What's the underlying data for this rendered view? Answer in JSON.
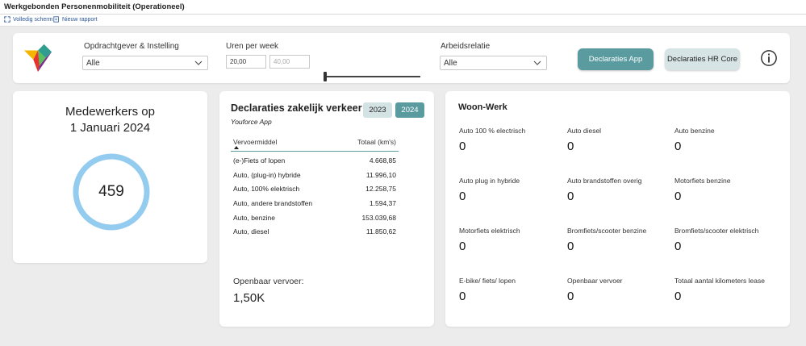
{
  "window": {
    "title": "Werkgebonden Personenmobiliteit (Operationeel)"
  },
  "toolbar": {
    "fullscreen_label": "Volledig scherm",
    "new_report_label": "Nieuw rapport"
  },
  "filters": {
    "employer": {
      "label": "Opdrachtgever & Instelling",
      "value": "Alle"
    },
    "hours": {
      "label": "Uren per week",
      "min": "20,00",
      "max": "40,00",
      "selected_fraction": 0.0
    },
    "relation": {
      "label": "Arbeidsrelatie",
      "value": "Alle"
    },
    "btn_app": "Declaraties App",
    "btn_hr": "Declaraties HR Core"
  },
  "employees": {
    "title_line1": "Medewerkers op",
    "title_line2": "1 Januari 2024",
    "count": "459"
  },
  "declaraties": {
    "title": "Declaraties zakelijk verkeer",
    "subtitle": "Youforce App",
    "years": [
      "2023",
      "2024"
    ],
    "active_year": "2024",
    "columns": [
      "Vervoermiddel",
      "Totaal (km's)"
    ],
    "rows": [
      {
        "mode": "(e-)Fiets of lopen",
        "km": "4.668,85"
      },
      {
        "mode": "Auto, (plug-in) hybride",
        "km": "11.996,10"
      },
      {
        "mode": "Auto, 100% elektrisch",
        "km": "12.258,75"
      },
      {
        "mode": "Auto, andere brandstoffen",
        "km": "1.594,37"
      },
      {
        "mode": "Auto, benzine",
        "km": "153.039,68"
      },
      {
        "mode": "Auto, diesel",
        "km": "11.850,62"
      }
    ],
    "public_transport_label": "Openbaar vervoer:",
    "public_transport_value": "1,50K"
  },
  "woonwerk": {
    "title": "Woon-Werk",
    "items": [
      {
        "label": "Auto 100 % electrisch",
        "value": "0"
      },
      {
        "label": "Auto diesel",
        "value": "0"
      },
      {
        "label": "Auto benzine",
        "value": "0"
      },
      {
        "label": "Auto plug in hybride",
        "value": "0"
      },
      {
        "label": "Auto brandstoffen overig",
        "value": "0"
      },
      {
        "label": "Motorfiets benzine",
        "value": "0"
      },
      {
        "label": "Motorfiets elektrisch",
        "value": "0"
      },
      {
        "label": "Bromfiets/scooter benzine",
        "value": "0"
      },
      {
        "label": "Bromfiets/scooter elektrisch",
        "value": "0"
      },
      {
        "label": "E-bike/ fiets/ lopen",
        "value": "0"
      },
      {
        "label": "Openbaar vervoer",
        "value": "0"
      },
      {
        "label": "Totaal aantal kilometers lease",
        "value": "0"
      }
    ]
  },
  "colors": {
    "accent": "#5a9ba0",
    "accent_light": "#d3e2e3",
    "ring": "#94ccf0"
  }
}
